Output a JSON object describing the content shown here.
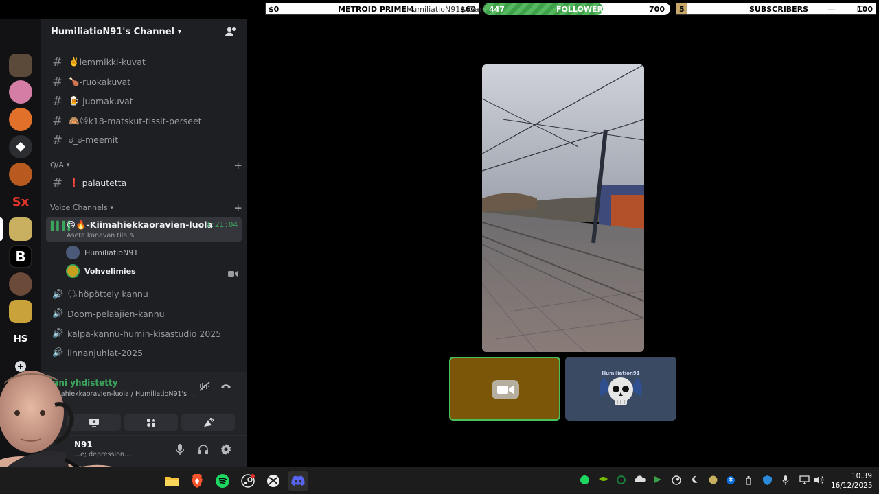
{
  "overlay": {
    "game": {
      "amount_left": "$0",
      "title": "METROID PRIME 4",
      "sub": "HumiliatioN91's Game",
      "amount_right": "$60"
    },
    "followers": {
      "current": "447",
      "label": "FOLLOWERS",
      "goal": "700",
      "progress_fraction": 0.64
    },
    "subscribers": {
      "current": "5",
      "label": "SUBSCRIBERS",
      "goal": "100",
      "window_controls": "— ☐",
      "progress_fraction": 0.05
    }
  },
  "servers": [
    {
      "name": "server-bottle",
      "color": "#5b4a3a"
    },
    {
      "name": "server-pink-eye",
      "color": "#d47ea5"
    },
    {
      "name": "server-music",
      "color": "#e0702a"
    },
    {
      "name": "server-discovery",
      "color": "#2b2d31"
    },
    {
      "name": "server-fighter",
      "color": "#b85a20"
    },
    {
      "name": "server-sx",
      "color": "#121214"
    },
    {
      "name": "server-pepe",
      "color": "#c8b060"
    },
    {
      "name": "server-b",
      "color": "#000000"
    },
    {
      "name": "server-freddy",
      "color": "#6b4a3a"
    },
    {
      "name": "server-shield",
      "color": "#c9a23a"
    },
    {
      "name": "server-hs",
      "label": "HS",
      "color": "#121214"
    }
  ],
  "guild": {
    "name": "HumiliatioN91's Channel"
  },
  "channels": [
    {
      "emoji": "✌️",
      "name": "lemmikki-kuvat"
    },
    {
      "emoji": "🍗",
      "name": "-ruokakuvat"
    },
    {
      "emoji": "🍺",
      "name": "-juomakuvat"
    },
    {
      "emoji": "🙈😘",
      "name": "k18-matskut-tissit-perseet"
    },
    {
      "emoji": "",
      "name": "ಠ_ಠ-meemit"
    }
  ],
  "qa": {
    "label": "Q/A",
    "channel": "palautetta",
    "emoji": "❗"
  },
  "voice": {
    "label": "Voice Channels",
    "active": {
      "name": "😘🔥-Kiimahiekkaoravien-luola",
      "time": "1:21:04",
      "status": "Aseta kanavan tila"
    },
    "users": [
      "HumiliatioN91",
      "Vohvelimies"
    ],
    "others": [
      "🗣höpöttely kannu",
      "Doom-pelaajien-kannu",
      "kalpa-kannu-humin-kisastudio 2025",
      "linnanjuhlat-2025"
    ]
  },
  "panel": {
    "connected": "Ääni yhdistetty",
    "path": "Kiimahiekkaoravien-luola / HumiliatioN91's ...",
    "username": "N91",
    "status": "...e; depression..."
  },
  "clock": {
    "time": "10.39",
    "date": "16/12/2025"
  }
}
